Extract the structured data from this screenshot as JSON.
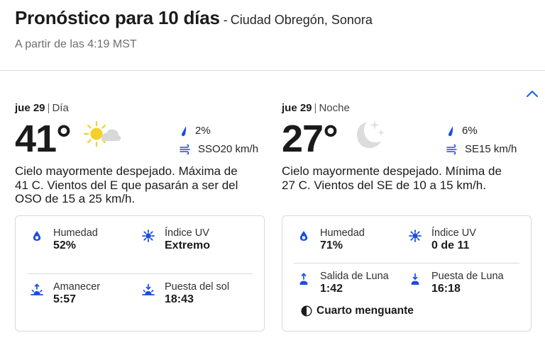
{
  "header": {
    "title": "Pronóstico para 10 días",
    "separator": "-",
    "location": "Ciudad Obregón, Sonora",
    "as_of": "A partir de las 4:19 MST"
  },
  "day": {
    "date": "jue 29",
    "bar": "|",
    "part": "Día",
    "temp": "41°",
    "condition_icon": "mostly-sunny-icon",
    "precip": "2%",
    "wind": "SSO20 km/h",
    "narrative": "Cielo mayormente despejado. Máxima de 41 C. Vientos del E que pasarán a ser del OSO de 15 a 25 km/h.",
    "humidity_label": "Humedad",
    "humidity_value": "52%",
    "uv_label": "Índice UV",
    "uv_value": "Extremo",
    "sunrise_label": "Amanecer",
    "sunrise_value": "5:57",
    "sunset_label": "Puesta del sol",
    "sunset_value": "18:43"
  },
  "night": {
    "date": "jue 29",
    "bar": "|",
    "part": "Noche",
    "temp": "27°",
    "condition_icon": "clear-night-icon",
    "precip": "6%",
    "wind": "SE15 km/h",
    "narrative": "Cielo mayormente despejado. Mínima de 27 C. Vientos del SE de 10 a 15 km/h.",
    "humidity_label": "Humedad",
    "humidity_value": "71%",
    "uv_label": "Índice UV",
    "uv_value": "0 de 11",
    "moonrise_label": "Salida de Luna",
    "moonrise_value": "1:42",
    "moonset_label": "Puesta de Luna",
    "moonset_value": "16:18",
    "moon_phase": "Cuarto menguante"
  },
  "colors": {
    "accent": "#1a5fe0",
    "icon_blue": "#1b4de4",
    "sun_yellow": "#f5cf2a",
    "cloud_gray": "#d8d8d8",
    "moon_gray": "#dcdcdc",
    "divider": "#dedede"
  }
}
